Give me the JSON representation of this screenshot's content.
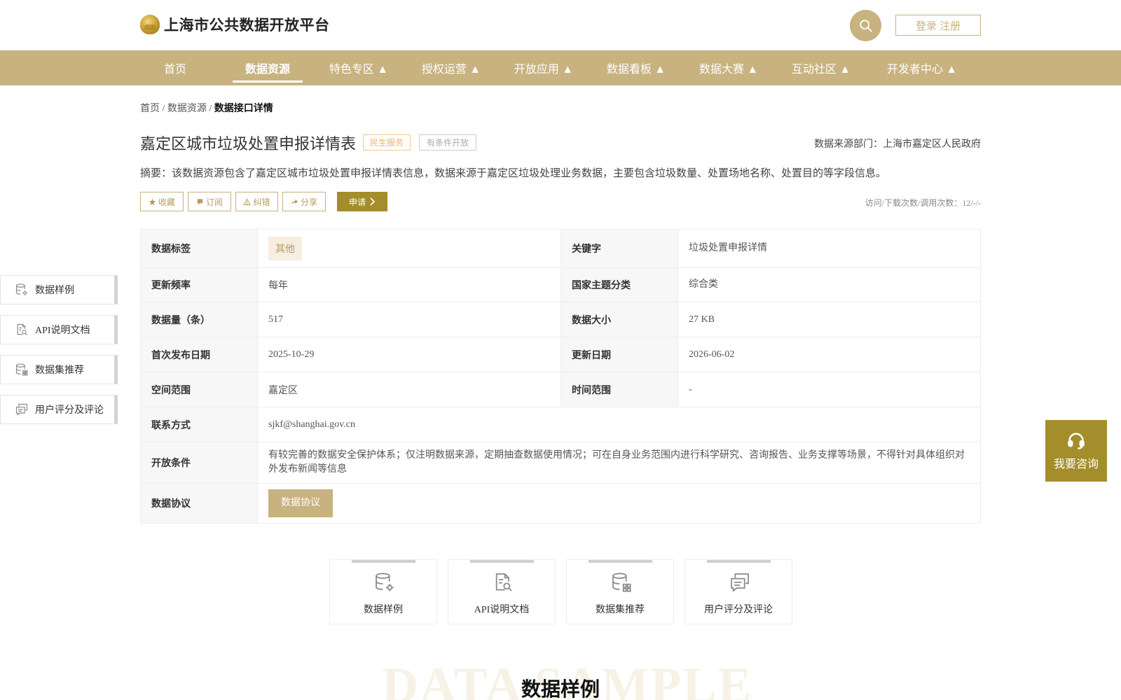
{
  "header": {
    "site_title": "上海市公共数据开放平台",
    "login_label": "登录 注册"
  },
  "nav": [
    {
      "label": "首页"
    },
    {
      "label": "数据资源"
    },
    {
      "label": "特色专区 ▲"
    },
    {
      "label": "授权运营 ▲"
    },
    {
      "label": "开放应用 ▲"
    },
    {
      "label": "数据看板 ▲"
    },
    {
      "label": "数据大赛 ▲"
    },
    {
      "label": "互动社区 ▲"
    },
    {
      "label": "开发者中心 ▲"
    }
  ],
  "breadcrumb": {
    "home": "首页",
    "sep1": " / ",
    "resources": "数据资源",
    "sep2": " / ",
    "current": "数据接口详情"
  },
  "dataset": {
    "title": "嘉定区城市垃圾处置申报详情表",
    "tag_service": "民生服务",
    "tag_open": "有条件开放",
    "department": "数据来源部门：上海市嘉定区人民政府",
    "summary": "摘要：该数据资源包含了嘉定区城市垃圾处置申报详情表信息，数据来源于嘉定区垃圾处理业务数据，主要包含垃圾数量、处置场地名称、处置目的等字段信息。",
    "visits": "访问/下载次数/调用次数：12/-/-"
  },
  "actions": {
    "favorite": "收藏",
    "subscribe": "订阅",
    "report": "纠错",
    "share": "分享",
    "apply": "申请"
  },
  "info": {
    "tag_label": "数据标签",
    "tag_value": "其他",
    "keyword_label": "关键字",
    "keyword_value": "垃圾处置申报详情",
    "freq_label": "更新频率",
    "freq_value": "每年",
    "theme_label": "国家主题分类",
    "theme_value": "综合类",
    "count_label": "数据量（条）",
    "count_value": "517",
    "size_label": "数据大小",
    "size_value": "27 KB",
    "first_label": "首次发布日期",
    "first_value": "2025-10-29",
    "update_label": "更新日期",
    "update_value": "2026-06-02",
    "space_label": "空间范围",
    "space_value": "嘉定区",
    "time_label": "时间范围",
    "time_value": "-",
    "contact_label": "联系方式",
    "contact_value": "sjkf@shanghai.gov.cn",
    "cond_label": "开放条件",
    "cond_value": "有较完善的数据安全保护体系；仅注明数据来源，定期抽查数据使用情况；可在自身业务范围内进行科学研究、咨询报告、业务支撑等场景，不得针对具体组织对外发布新闻等信息",
    "proto_label": "数据协议",
    "proto_button": "数据协议"
  },
  "sidebar": [
    {
      "label": "数据样例",
      "icon": "database-gear-icon"
    },
    {
      "label": "API说明文档",
      "icon": "document-search-icon"
    },
    {
      "label": "数据集推荐",
      "icon": "database-grid-icon"
    },
    {
      "label": "用户评分及评论",
      "icon": "comments-icon"
    }
  ],
  "cards": [
    {
      "label": "数据样例",
      "icon": "database-gear-icon"
    },
    {
      "label": "API说明文档",
      "icon": "document-search-icon"
    },
    {
      "label": "数据集推荐",
      "icon": "database-grid-icon"
    },
    {
      "label": "用户评分及评论",
      "icon": "comments-icon"
    }
  ],
  "section": {
    "watermark": "DATA SAMPLE",
    "title": "数据样例"
  },
  "consult": {
    "label": "我要咨询"
  },
  "colors": {
    "brand": "#c8b27f",
    "accent": "#a48d2b"
  }
}
